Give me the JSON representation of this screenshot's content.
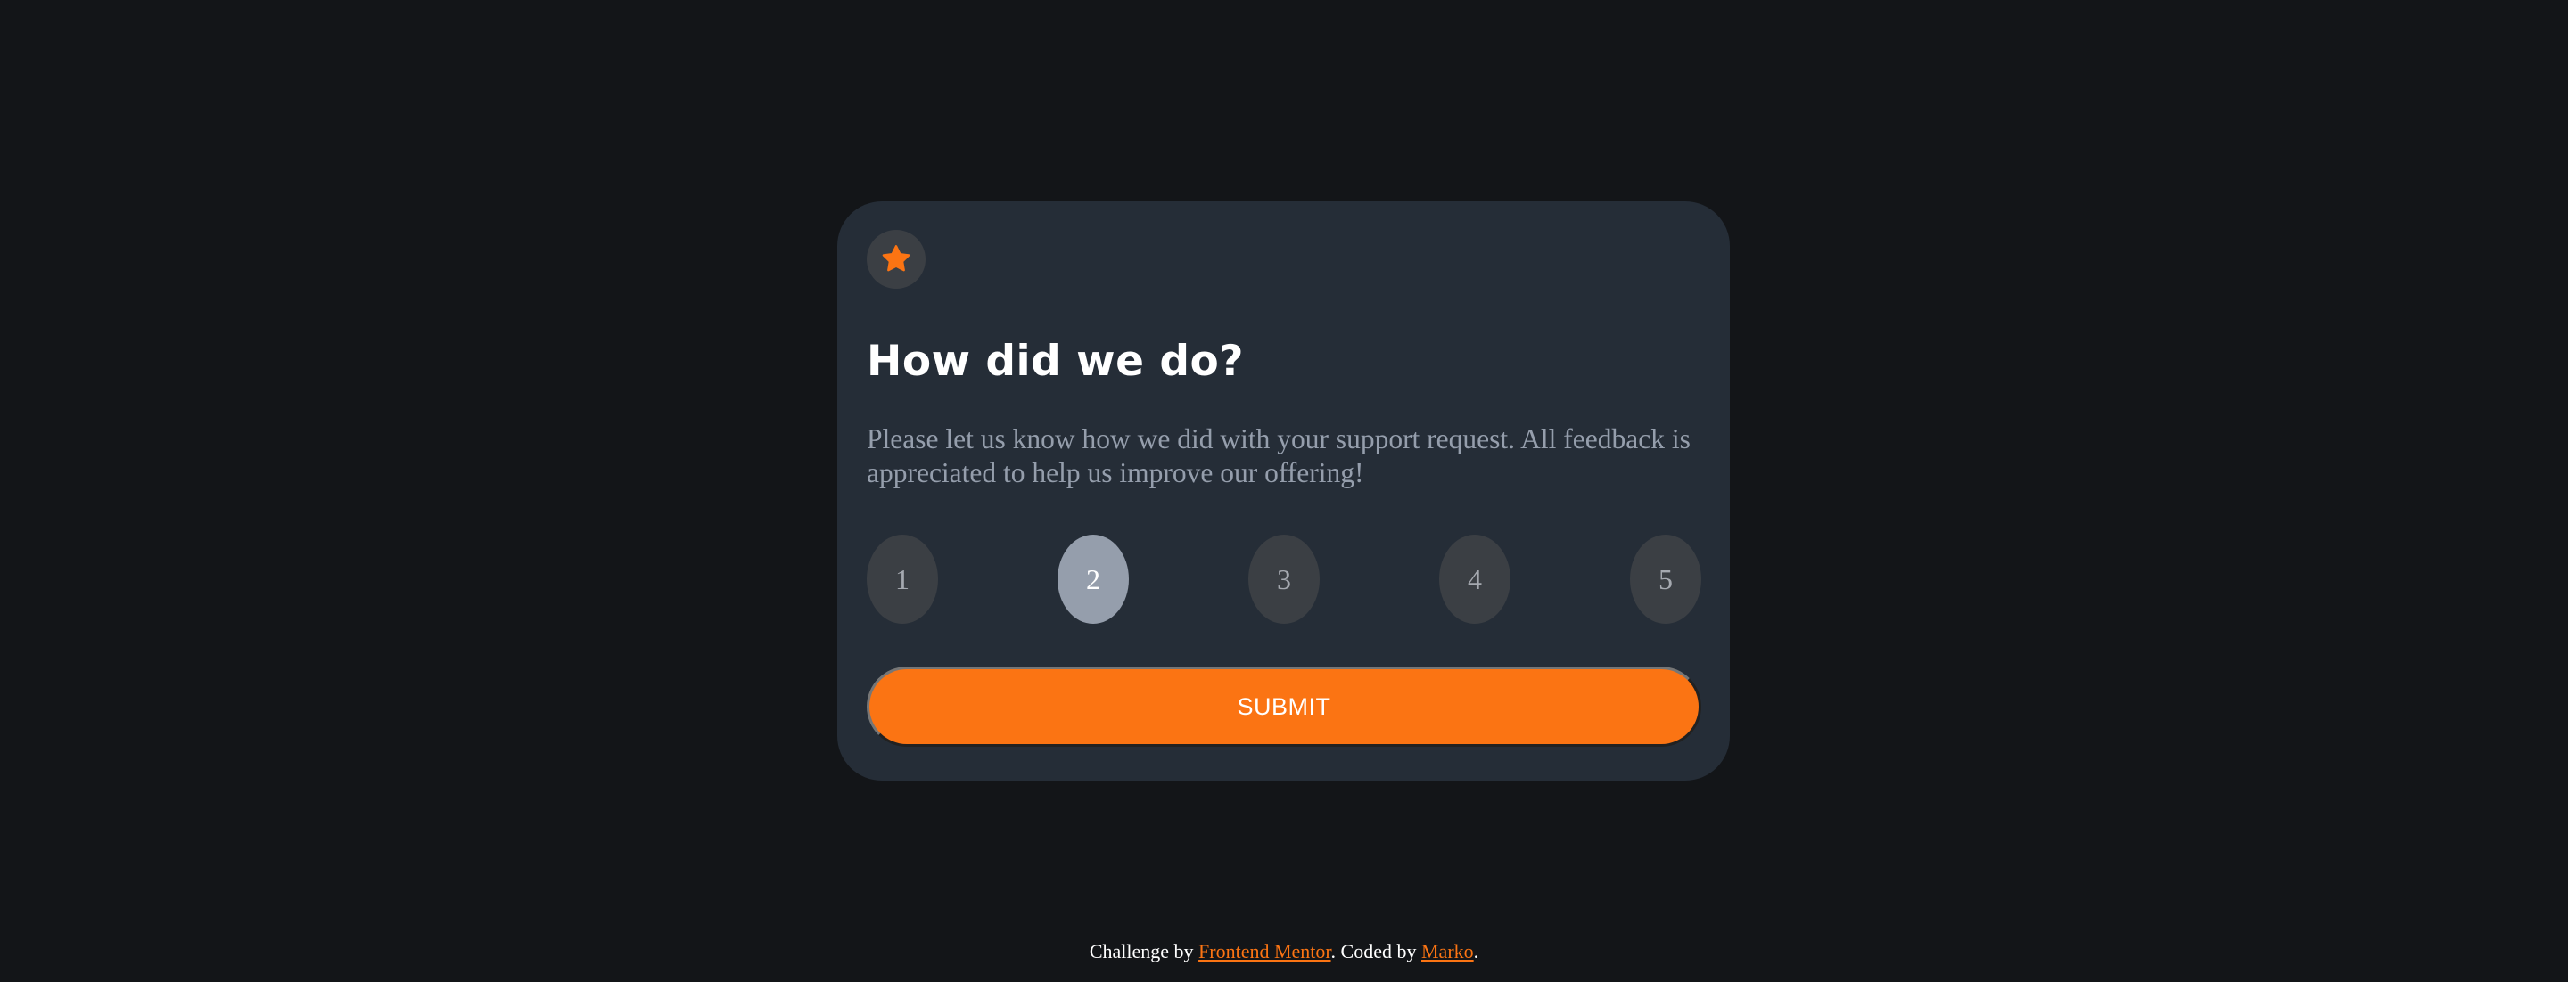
{
  "card": {
    "icon": "star-icon",
    "title": "How did we do?",
    "description": "Please let us know how we did with your support request. All feedback is appreciated to help us improve our offering!",
    "ratings": [
      "1",
      "2",
      "3",
      "4",
      "5"
    ],
    "selected_rating": "2",
    "submit_label": "SUBMIT"
  },
  "footer": {
    "prefix": "Challenge by ",
    "link1": "Frontend Mentor",
    "middle": ". Coded by ",
    "link2": "Marko",
    "suffix": "."
  },
  "colors": {
    "background": "#131518",
    "card": "#252d37",
    "accent": "#fb7413",
    "muted": "#959eac",
    "circle": "#3b3f44"
  }
}
